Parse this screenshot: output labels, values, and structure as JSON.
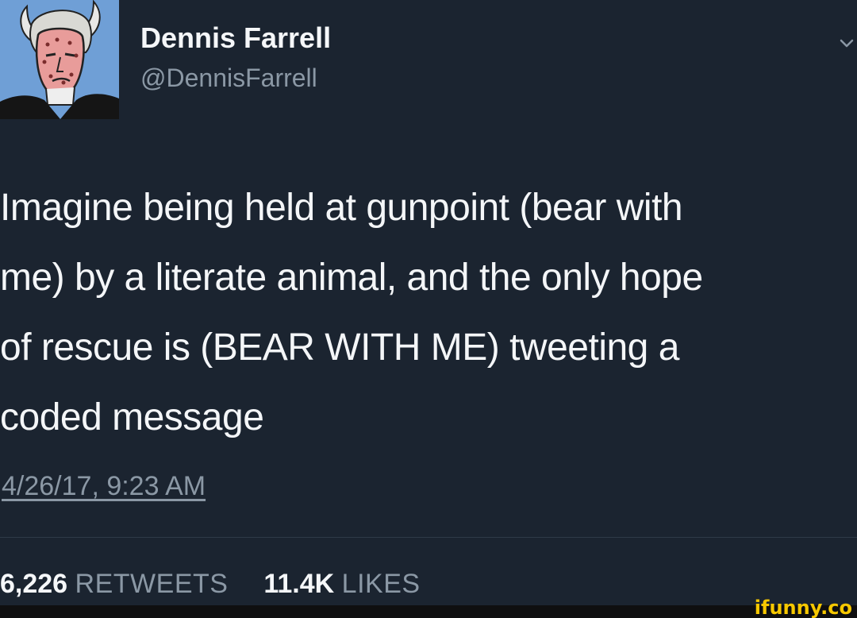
{
  "tweet": {
    "author": {
      "name": "Dennis Farrell",
      "handle": "@DennisFarrell",
      "avatar_bg": "#6f9fd6"
    },
    "text_lines": [
      "Imagine being held at gunpoint (bear with",
      "me) by a literate animal, and the only hope",
      "of rescue is (BEAR WITH ME) tweeting a",
      "coded message"
    ],
    "timestamp": "4/26/17, 9:23 AM",
    "stats": {
      "retweets_count": "6,226",
      "retweets_label": "RETWEETS",
      "likes_count": "11.4K",
      "likes_label": "LIKES"
    },
    "menu_icon": "chevron-down-icon"
  },
  "watermark": {
    "text": "ifunny.co",
    "color": "#f7c800"
  },
  "colors": {
    "background": "#1b2430",
    "primary_text": "#f4f6f8",
    "secondary_text": "#8b98a5"
  }
}
